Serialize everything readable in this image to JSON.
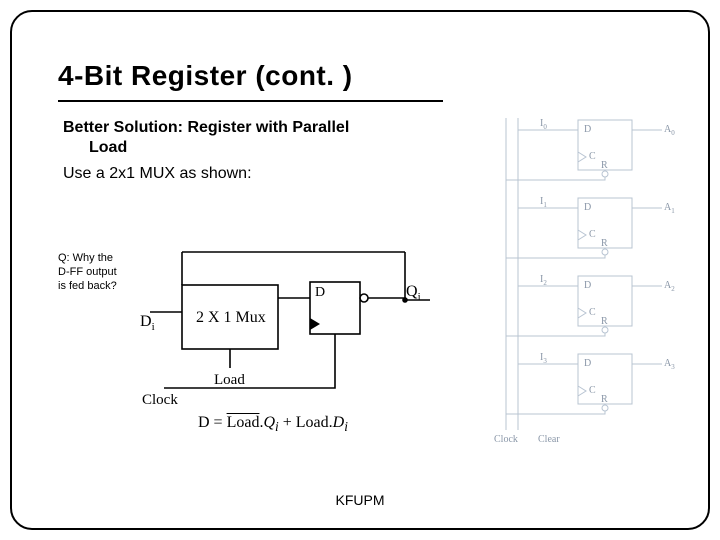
{
  "title": "4-Bit Register (cont. )",
  "body": {
    "line1a": "Better Solution: Register with Parallel",
    "line1b": "Load",
    "line2": "Use a 2x1 MUX as shown:"
  },
  "note": {
    "l1": "Q: Why the",
    "l2": "D-FF output",
    "l3": "is fed back?"
  },
  "mux": {
    "box_label": "2 X 1 Mux",
    "d_in": "D",
    "q_out": "Q",
    "q_sub": "i",
    "d_label": "D",
    "d_sub": "i",
    "load": "Load",
    "clock": "Clock"
  },
  "equation": {
    "lhs": "D = ",
    "term1_bar": "Load",
    "dot": ".",
    "q": "Q",
    "qi": "i",
    "plus": " + ",
    "term2": "Load",
    "d": "D",
    "di": "i"
  },
  "right": {
    "inputs": [
      "I",
      "I",
      "I",
      "I"
    ],
    "input_sub": [
      "0",
      "1",
      "2",
      "3"
    ],
    "outputs": [
      "A",
      "A",
      "A",
      "A"
    ],
    "output_sub": [
      "0",
      "1",
      "2",
      "3"
    ],
    "cell_d": "D",
    "cell_c": "C",
    "cell_r": "R",
    "clock_label": "Clock",
    "clear_label": "Clear"
  },
  "footer": "KFUPM"
}
